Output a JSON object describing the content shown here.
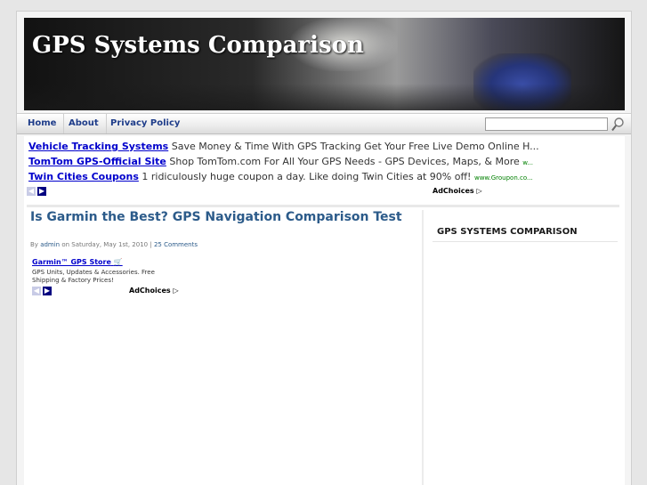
{
  "site": {
    "title": "GPS Systems Comparison"
  },
  "nav": [
    {
      "label": "Home"
    },
    {
      "label": "About"
    },
    {
      "label": "Privacy Policy"
    }
  ],
  "search": {
    "placeholder": ""
  },
  "ads": [
    {
      "title": "Vehicle Tracking Systems",
      "text": "Save Money & Time With GPS Tracking Get Your Free Live Demo Online H...",
      "url": ""
    },
    {
      "title": "TomTom GPS-Official Site",
      "text": "Shop TomTom.com For All Your GPS Needs - GPS Devices, Maps, & More",
      "url": "w..."
    },
    {
      "title": "Twin Cities Coupons",
      "text": "1 ridiculously huge coupon a day. Like doing Twin Cities at 90% off!",
      "url": "www.Groupon.co..."
    }
  ],
  "adchoices_label": "AdChoices",
  "post": {
    "title": "Is Garmin the Best? GPS Navigation Comparison Test",
    "meta_by": "By",
    "author": "admin",
    "meta_on": "on Saturday, May 1st, 2010 |",
    "comments": "25 Comments"
  },
  "ad2": {
    "title": "Garmin™ GPS Store",
    "desc": "GPS Units, Updates & Accessories. Free Shipping & Factory Prices!"
  },
  "sidebar": {
    "title": "GPS SYSTEMS COMPARISON"
  },
  "colors": {
    "link": "#0000cc",
    "post_title": "#2c5b8a",
    "nav_text": "#1f3d8a"
  }
}
